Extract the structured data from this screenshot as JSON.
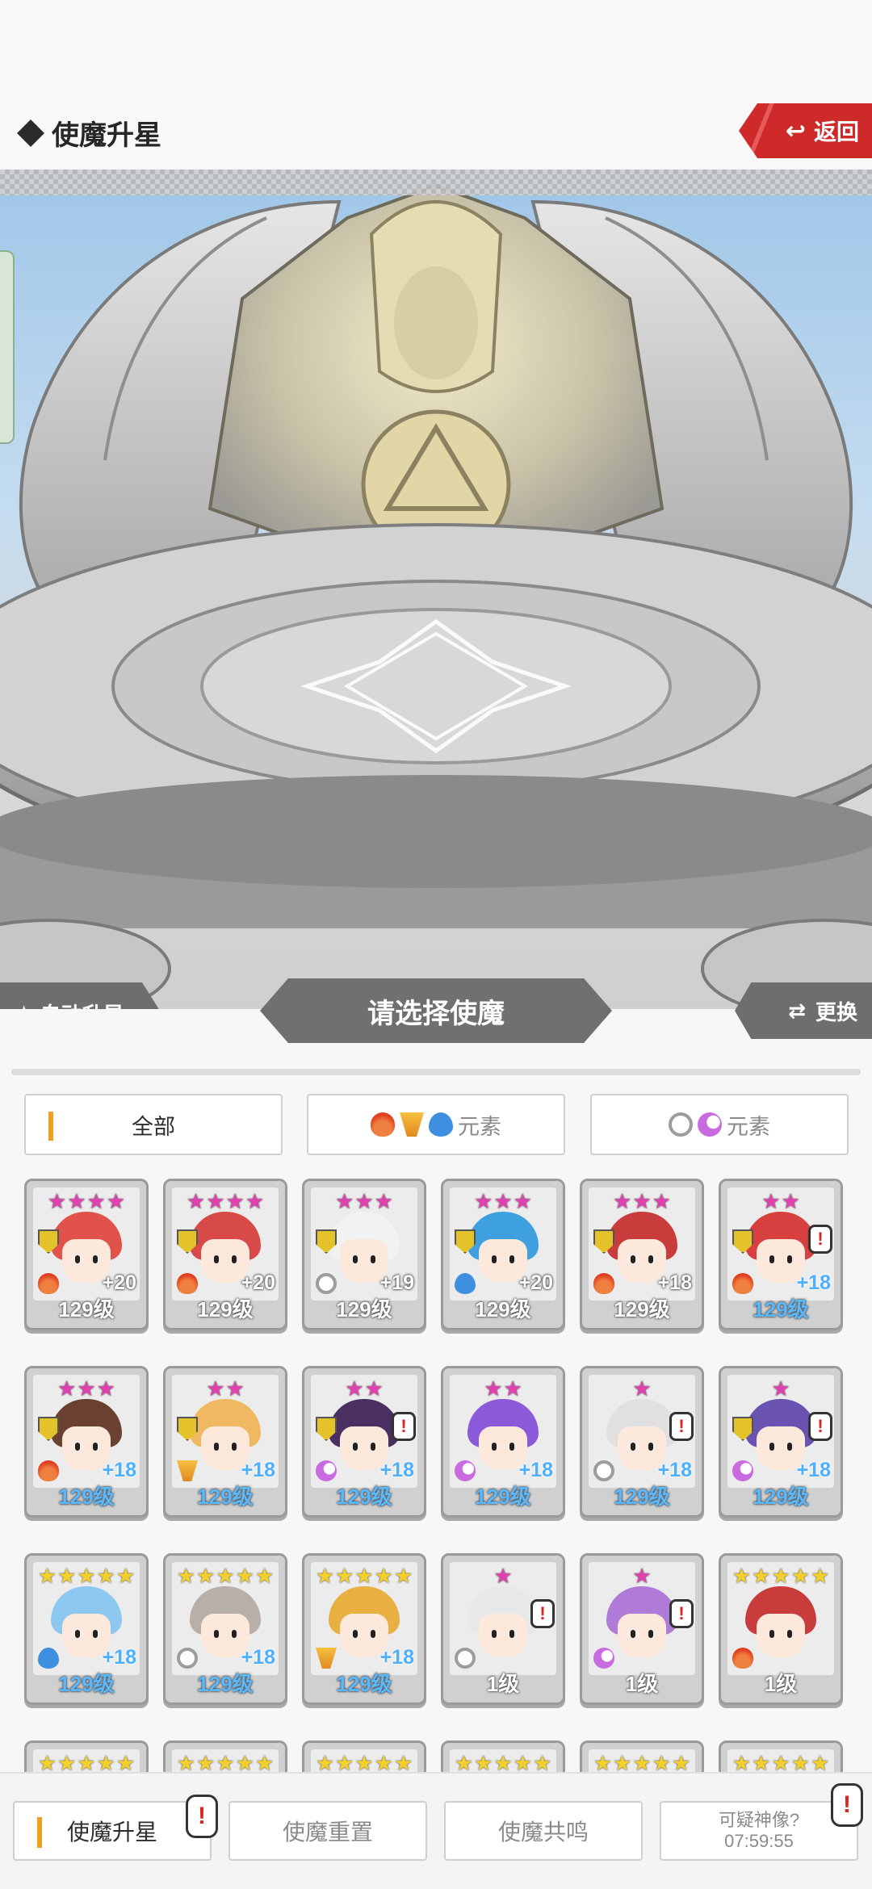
{
  "header": {
    "title": "使魔升星",
    "back_label": "返回"
  },
  "scene": {
    "auto_label": "自动升星",
    "select_label": "请选择使魔",
    "swap_label": "更换"
  },
  "filters": [
    {
      "label": "全部",
      "active": true,
      "icons": []
    },
    {
      "label": "元素",
      "active": false,
      "icons": [
        "fire-icon",
        "wind-icon",
        "water-icon"
      ]
    },
    {
      "label": "元素",
      "active": false,
      "icons": [
        "light-icon",
        "dark-icon"
      ]
    }
  ],
  "cards": [
    {
      "stars": 4,
      "star_color": "pink",
      "shield": true,
      "alert": false,
      "element": "fire",
      "plus": "+20",
      "plus_blue": false,
      "level": "129级",
      "level_blue": false,
      "hair": "#e0524a"
    },
    {
      "stars": 4,
      "star_color": "pink",
      "shield": true,
      "alert": false,
      "element": "fire",
      "plus": "+20",
      "plus_blue": false,
      "level": "129级",
      "level_blue": false,
      "hair": "#d84a48"
    },
    {
      "stars": 3,
      "star_color": "pink",
      "shield": true,
      "alert": false,
      "element": "light",
      "plus": "+19",
      "plus_blue": false,
      "level": "129级",
      "level_blue": false,
      "hair": "#f2f2f2"
    },
    {
      "stars": 3,
      "star_color": "pink",
      "shield": true,
      "alert": false,
      "element": "water",
      "plus": "+20",
      "plus_blue": false,
      "level": "129级",
      "level_blue": false,
      "hair": "#3fa0e0"
    },
    {
      "stars": 3,
      "star_color": "pink",
      "shield": true,
      "alert": false,
      "element": "fire",
      "plus": "+18",
      "plus_blue": false,
      "level": "129级",
      "level_blue": false,
      "hair": "#c83c3c"
    },
    {
      "stars": 2,
      "star_color": "pink",
      "shield": true,
      "alert": true,
      "element": "fire",
      "plus": "+18",
      "plus_blue": true,
      "level": "129级",
      "level_blue": true,
      "hair": "#d84040"
    },
    {
      "stars": 3,
      "star_color": "pink",
      "shield": true,
      "alert": false,
      "element": "fire",
      "plus": "+18",
      "plus_blue": true,
      "level": "129级",
      "level_blue": true,
      "hair": "#6a4030"
    },
    {
      "stars": 2,
      "star_color": "pink",
      "shield": true,
      "alert": false,
      "element": "wind",
      "plus": "+18",
      "plus_blue": true,
      "level": "129级",
      "level_blue": true,
      "hair": "#f0b860"
    },
    {
      "stars": 2,
      "star_color": "pink",
      "shield": true,
      "alert": true,
      "element": "dark",
      "plus": "+18",
      "plus_blue": true,
      "level": "129级",
      "level_blue": true,
      "hair": "#4a3060"
    },
    {
      "stars": 2,
      "star_color": "pink",
      "shield": false,
      "alert": false,
      "element": "dark",
      "plus": "+18",
      "plus_blue": true,
      "level": "129级",
      "level_blue": true,
      "hair": "#8a5ad8"
    },
    {
      "stars": 1,
      "star_color": "pink",
      "shield": false,
      "alert": true,
      "element": "light",
      "plus": "+18",
      "plus_blue": true,
      "level": "129级",
      "level_blue": true,
      "hair": "#e0e0e0"
    },
    {
      "stars": 1,
      "star_color": "pink",
      "shield": true,
      "alert": true,
      "element": "dark",
      "plus": "+18",
      "plus_blue": true,
      "level": "129级",
      "level_blue": true,
      "hair": "#6a52b0"
    },
    {
      "stars": 5,
      "star_color": "gold",
      "shield": false,
      "alert": false,
      "element": "water",
      "plus": "+18",
      "plus_blue": true,
      "level": "129级",
      "level_blue": true,
      "hair": "#8cc8f0"
    },
    {
      "stars": 5,
      "star_color": "gold",
      "shield": false,
      "alert": false,
      "element": "light",
      "plus": "+18",
      "plus_blue": true,
      "level": "129级",
      "level_blue": true,
      "hair": "#b8b0a8"
    },
    {
      "stars": 5,
      "star_color": "gold",
      "shield": false,
      "alert": false,
      "element": "wind",
      "plus": "+18",
      "plus_blue": true,
      "level": "129级",
      "level_blue": true,
      "hair": "#e8b040"
    },
    {
      "stars": 1,
      "star_color": "pink",
      "shield": false,
      "alert": true,
      "element": "light",
      "plus": "",
      "plus_blue": false,
      "level": "1级",
      "level_blue": false,
      "hair": "#e8e8e8"
    },
    {
      "stars": 1,
      "star_color": "pink",
      "shield": false,
      "alert": true,
      "element": "dark",
      "plus": "",
      "plus_blue": false,
      "level": "1级",
      "level_blue": false,
      "hair": "#b07ad8"
    },
    {
      "stars": 5,
      "star_color": "gold",
      "shield": false,
      "alert": false,
      "element": "fire",
      "plus": "",
      "plus_blue": false,
      "level": "1级",
      "level_blue": false,
      "hair": "#c83c3c"
    },
    {
      "stars": 5,
      "star_color": "gold",
      "shield": false,
      "alert": false,
      "element": "",
      "plus": "",
      "plus_blue": false,
      "level": "",
      "level_blue": false,
      "hair": "#e0e0e0"
    },
    {
      "stars": 5,
      "star_color": "gold",
      "shield": false,
      "alert": false,
      "element": "",
      "plus": "",
      "plus_blue": false,
      "level": "",
      "level_blue": false,
      "hair": "#e0e0e0"
    },
    {
      "stars": 5,
      "star_color": "gold",
      "shield": false,
      "alert": false,
      "element": "",
      "plus": "",
      "plus_blue": false,
      "level": "",
      "level_blue": false,
      "hair": "#e0e0e0"
    },
    {
      "stars": 5,
      "star_color": "gold",
      "shield": false,
      "alert": false,
      "element": "",
      "plus": "",
      "plus_blue": false,
      "level": "",
      "level_blue": false,
      "hair": "#e0e0e0"
    },
    {
      "stars": 5,
      "star_color": "gold",
      "shield": false,
      "alert": false,
      "element": "",
      "plus": "",
      "plus_blue": false,
      "level": "",
      "level_blue": false,
      "hair": "#e0e0e0"
    },
    {
      "stars": 5,
      "star_color": "gold",
      "shield": false,
      "alert": false,
      "element": "",
      "plus": "",
      "plus_blue": false,
      "level": "",
      "level_blue": false,
      "hair": "#e0e0e0"
    }
  ],
  "bottom_nav": [
    {
      "label": "使魔升星",
      "active": true,
      "badge": true
    },
    {
      "label": "使魔重置",
      "active": false,
      "badge": false
    },
    {
      "label": "使魔共鸣",
      "active": false,
      "badge": false
    },
    {
      "label": "可疑神像?",
      "sub": "07:59:55",
      "active": false,
      "badge": true
    }
  ],
  "colors": {
    "accent": "#f0a020",
    "back_red": "#cf2a2a",
    "level_blue": "#5ab8ff"
  }
}
